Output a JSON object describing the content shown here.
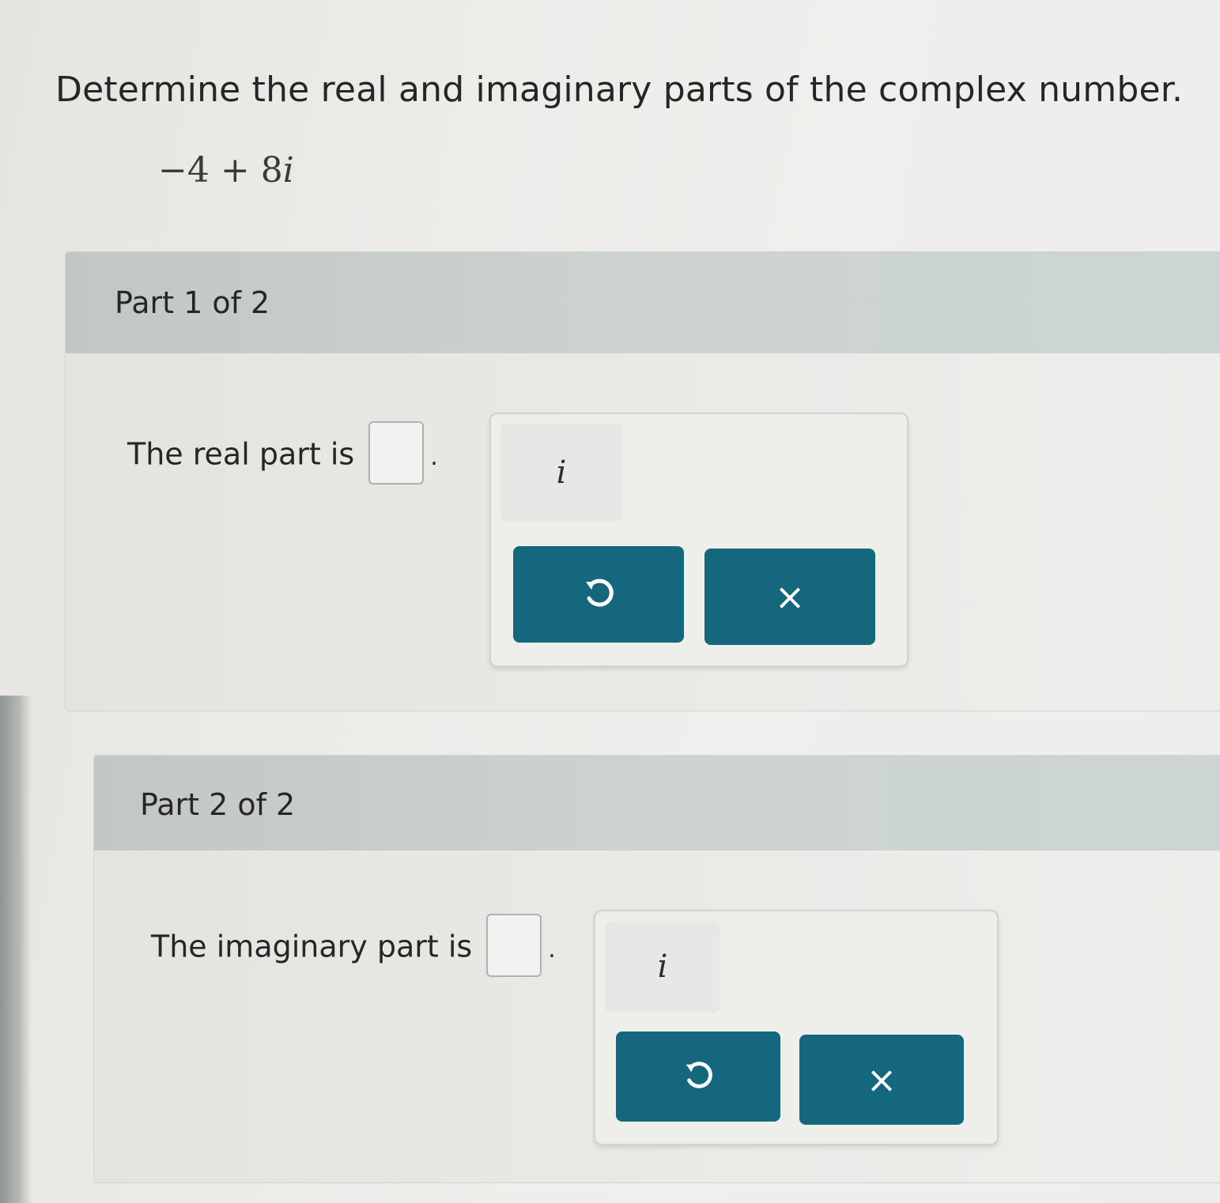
{
  "question": {
    "text": "Determine the real and imaginary parts of the complex number.",
    "expression_parts": [
      "−4",
      "+",
      "8",
      "i"
    ]
  },
  "parts": [
    {
      "title": "Part 1 of 2",
      "prompt": "The real part is",
      "answer_value": "",
      "period": ".",
      "keypad": {
        "i_key": "i",
        "undo_icon": "undo-icon",
        "clear_label": "×"
      }
    },
    {
      "title": "Part 2 of 2",
      "prompt": "The imaginary part is",
      "answer_value": "",
      "period": ".",
      "keypad": {
        "i_key": "i",
        "undo_icon": "undo-icon",
        "clear_label": "×"
      }
    }
  ],
  "colors": {
    "button": "#15677e",
    "header": "#c9cfce"
  }
}
